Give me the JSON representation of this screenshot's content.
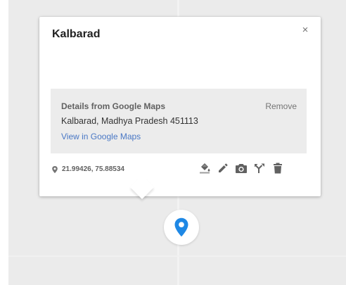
{
  "place": {
    "title": "Kalbarad",
    "close_glyph": "×"
  },
  "details": {
    "heading": "Details from Google Maps",
    "remove_label": "Remove",
    "address": "Kalbarad, Madhya Pradesh 451113",
    "link_label": "View in Google Maps"
  },
  "location": {
    "coordinates": "21.99426, 75.88534"
  },
  "actions": [
    {
      "icon": "paint-bucket-icon"
    },
    {
      "icon": "pencil-icon"
    },
    {
      "icon": "camera-icon"
    },
    {
      "icon": "directions-fork-icon"
    },
    {
      "icon": "trash-icon"
    }
  ],
  "marker": {
    "icon": "location-pin-icon",
    "color": "#1e88e5"
  },
  "colors": {
    "map_background": "#ebebeb",
    "link": "#4a78c5",
    "icon_gray": "#616161"
  }
}
